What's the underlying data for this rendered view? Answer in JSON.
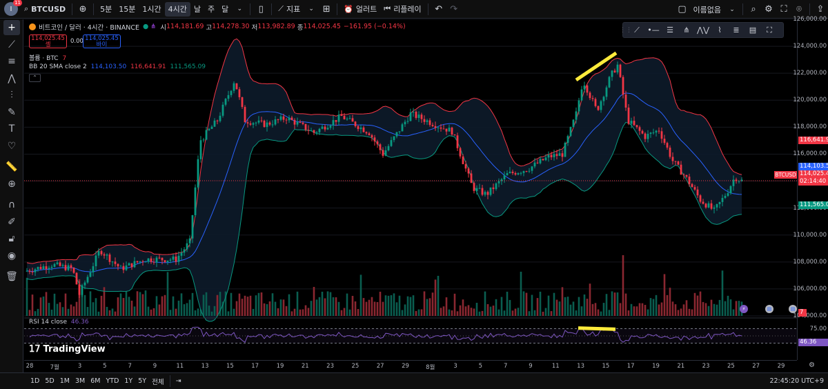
{
  "topbar": {
    "badge": "11",
    "symbol": "BTCUSD",
    "intervals": [
      "5분",
      "15분",
      "1시간",
      "4시간",
      "날",
      "주",
      "달"
    ],
    "active_interval": "4시간",
    "indicators_label": "지표",
    "alert_label": "얼러트",
    "replay_label": "리플레이",
    "layout_name": "이름없음"
  },
  "legend": {
    "title": "비트코인 / 달러 · 4시간 · BINANCE",
    "o_label": "시",
    "o": "114,181.69",
    "h_label": "고",
    "h": "114,278.30",
    "l_label": "저",
    "l": "113,982.89",
    "c_label": "종",
    "c": "114,025.45",
    "change": "−161.95 (−0.14%)",
    "sell_price": "114,025.45",
    "sell_label": "셀",
    "spread": "0.00",
    "buy_price": "114,025.45",
    "buy_label": "바이",
    "volume_label": "볼륨 · BTC",
    "volume_value": "7",
    "bb_label": "BB 20 SMA close 2",
    "bb_basis": "114,103.50",
    "bb_upper": "116,641.91",
    "bb_lower": "111,565.09",
    "rsi_label": "RSI 14 close",
    "rsi_value": "46.36"
  },
  "price_axis": {
    "labels": [
      "126,000.00",
      "124,000.00",
      "122,000.00",
      "120,000.00",
      "118,000.00",
      "116,000.00",
      "112,000.00",
      "110,000.00",
      "108,000.00",
      "106,000.00",
      "104,000.00"
    ],
    "tag_upper": "116,641.91",
    "tag_basis": "114,103.50",
    "tag_price": "114,025.45",
    "tag_countdown": "02:14:40",
    "tag_lower": "111,565.09",
    "symbol_tag": "BTCUSD",
    "rsi_labels": [
      "75.00",
      "25.00"
    ],
    "rsi_tag": "46.36",
    "vol_tag": "7"
  },
  "time_axis": [
    "28",
    "7월",
    "3",
    "5",
    "7",
    "9",
    "11",
    "13",
    "15",
    "17",
    "19",
    "21",
    "23",
    "25",
    "27",
    "29",
    "8월",
    "3",
    "5",
    "7",
    "9",
    "11",
    "13",
    "15",
    "17",
    "19",
    "21",
    "23",
    "25",
    "27",
    "29"
  ],
  "bottombar": {
    "ranges": [
      "1D",
      "5D",
      "1M",
      "3M",
      "6M",
      "YTD",
      "1Y",
      "5Y",
      "전체"
    ],
    "clock": "22:45:20 UTC+9"
  },
  "brand": "TradingView",
  "chart_data": {
    "type": "candlestick",
    "symbol": "BTCUSD",
    "timeframe": "4h",
    "ylim": [
      104000,
      126000
    ],
    "bollinger": {
      "basis": 114103.5,
      "upper": 116641.91,
      "lower": 111565.09
    },
    "last_price": 114025.45,
    "rsi": {
      "value": 46.36,
      "bands": [
        25,
        75
      ]
    },
    "highlights": [
      {
        "pane": "price",
        "from": 121500,
        "to": 123500,
        "color": "#ffeb3b"
      },
      {
        "pane": "rsi",
        "from": 77,
        "to": 73,
        "color": "#ffeb3b"
      }
    ],
    "colors": {
      "up": "#089981",
      "down": "#f23645",
      "bb_upper": "#f23645",
      "bb_lower": "#089981",
      "bb_basis": "#2962ff",
      "rsi": "#7e57c2"
    }
  }
}
